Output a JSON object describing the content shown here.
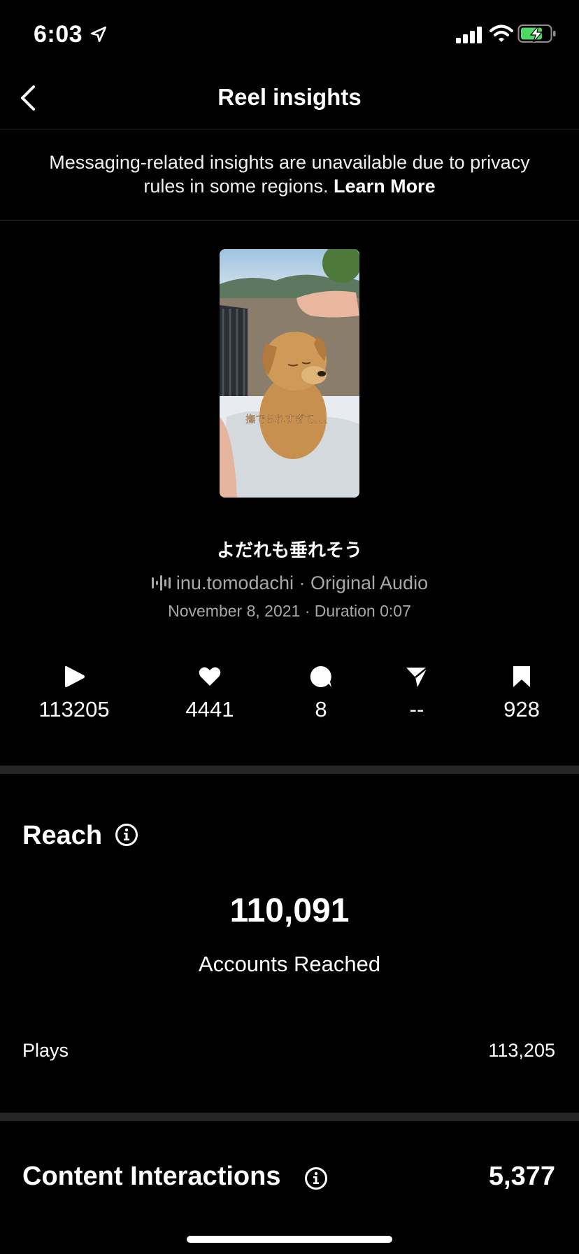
{
  "status": {
    "time": "6:03"
  },
  "nav": {
    "title": "Reel insights"
  },
  "notice": {
    "text": "Messaging-related insights are unavailable due to privacy rules in some regions.",
    "link": "Learn More"
  },
  "reel": {
    "overlay_text": "撫でられすぎて、、、",
    "caption": "よだれも垂れそう",
    "audio": "inu.tomodachi · Original Audio",
    "meta": "November 8, 2021 · Duration 0:07"
  },
  "stats": [
    {
      "icon": "play-icon",
      "value": "113205"
    },
    {
      "icon": "heart-icon",
      "value": "4441"
    },
    {
      "icon": "comment-icon",
      "value": "8"
    },
    {
      "icon": "share-icon",
      "value": "--"
    },
    {
      "icon": "bookmark-icon",
      "value": "928"
    }
  ],
  "reach": {
    "title": "Reach",
    "accounts_value": "110,091",
    "accounts_label": "Accounts Reached",
    "plays_label": "Plays",
    "plays_value": "113,205"
  },
  "interactions": {
    "title": "Content Interactions",
    "value": "5,377"
  },
  "colors": {
    "background": "#000000",
    "secondary_text": "#a8a8a8",
    "divider": "#262626",
    "battery_charging": "#4cd964"
  }
}
